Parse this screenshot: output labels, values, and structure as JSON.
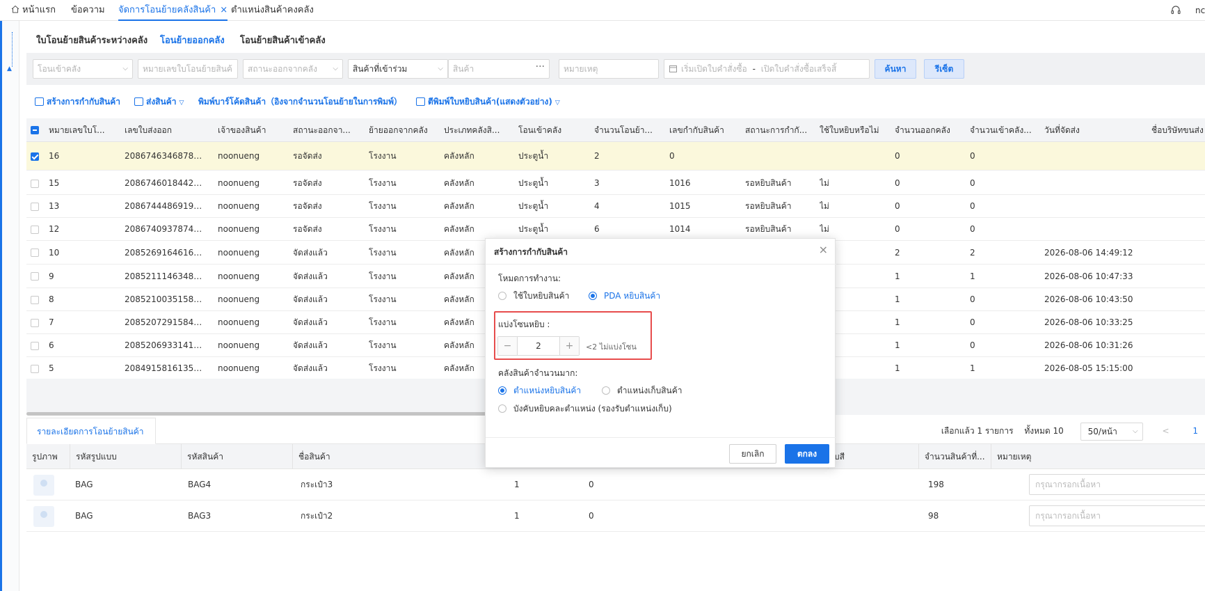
{
  "top_tabs": [
    {
      "label": "หน้าแรก"
    },
    {
      "label": "ข้อความ"
    },
    {
      "label": "จัดการโอนย้ายคลังสินค้า"
    },
    {
      "label": "ตำแหน่งสินค้าคงคลัง"
    }
  ],
  "top_right_text": "nc",
  "sub_tabs": [
    {
      "label": "ใบโอนย้ายสินค้าระหว่างคลัง"
    },
    {
      "label": "โอนย้ายออกคลัง"
    },
    {
      "label": "โอนย้ายสินค้าเข้าคลัง"
    }
  ],
  "filters": {
    "in_warehouse": "โอนเข้าคลัง",
    "transfer_no": "หมายเลขใบโอนย้ายสินค้",
    "out_status": "สถานะออกจากคลัง",
    "product_combo": "สินค้าที่เข้าร่วม",
    "product": "สินค้า",
    "remark": "หมายเหตุ",
    "date_start": "เริ่มเปิดใบคำสั่งซื้อ",
    "date_sep": "-",
    "date_end": "เปิดใบคำสั่งซื้อเสร็จสิ้",
    "search_label": "ค้นหา",
    "reset_label": "รีเซ็ต"
  },
  "actions": {
    "create_binding": "สร้างการกำกับสินค้า",
    "ship": "ส่งสินค้า",
    "print_barcode": "พิมพ์บาร์โค้ดสินค้า（อิงจากจำนวนโอนย้ายในการพิมพ์）",
    "print_pick": "ตีพิมพ์ใบหยิบสินค้า(แสดงตัวอย่าง)"
  },
  "table": {
    "headers": [
      "หมายเลขใบโ...",
      "เลขใบส่งออก",
      "เจ้าของสินค้า",
      "สถานะออกจา...",
      "ย้ายออกจากคลัง",
      "ประเภทคลังสิ...",
      "โอนเข้าคลัง",
      "จำนวนโอนย้า...",
      "เลขกำกับสินค้า",
      "สถานะการกำกั...",
      "ใช้ใบหยิบหรือไม่",
      "จำนวนออกคลัง",
      "จำนวนเข้าคลัง...",
      "วันที่จัดส่ง",
      "ชื่อบริษัทขนส่ง"
    ],
    "rows": [
      [
        "16",
        "208674634687836...",
        "noonueng",
        "รอจัดส่ง",
        "โรงงาน",
        "คลังหลัก",
        "ประตูน้ำ",
        "2",
        "0",
        "",
        "",
        "0",
        "0",
        ""
      ],
      [
        "15",
        "208674601844207...",
        "noonueng",
        "รอจัดส่ง",
        "โรงงาน",
        "คลังหลัก",
        "ประตูน้ำ",
        "3",
        "1016",
        "รอหยิบสินค้า",
        "ไม่",
        "0",
        "0",
        ""
      ],
      [
        "13",
        "208674448691949...",
        "noonueng",
        "รอจัดส่ง",
        "โรงงาน",
        "คลังหลัก",
        "ประตูน้ำ",
        "4",
        "1015",
        "รอหยิบสินค้า",
        "ไม่",
        "0",
        "0",
        ""
      ],
      [
        "12",
        "208674093787456...",
        "noonueng",
        "รอจัดส่ง",
        "โรงงาน",
        "คลังหลัก",
        "ประตูน้ำ",
        "6",
        "1014",
        "รอหยิบสินค้า",
        "ไม่",
        "0",
        "0",
        ""
      ],
      [
        "10",
        "208526916461642...",
        "noonueng",
        "จัดส่งแล้ว",
        "โรงงาน",
        "คลังหลัก",
        "",
        "",
        "",
        "",
        "",
        "2",
        "2",
        "2026-08-06 14:49:12"
      ],
      [
        "9",
        "208521114634899...",
        "noonueng",
        "จัดส่งแล้ว",
        "โรงงาน",
        "คลังหลัก",
        "",
        "",
        "",
        "",
        "",
        "1",
        "1",
        "2026-08-06 10:47:33"
      ],
      [
        "8",
        "208521003515832...",
        "noonueng",
        "จัดส่งแล้ว",
        "โรงงาน",
        "คลังหลัก",
        "",
        "",
        "",
        "",
        "",
        "1",
        "0",
        "2026-08-06 10:43:50"
      ],
      [
        "7",
        "208520729158438...",
        "noonueng",
        "จัดส่งแล้ว",
        "โรงงาน",
        "คลังหลัก",
        "",
        "",
        "",
        "",
        "",
        "1",
        "0",
        "2026-08-06 10:33:25"
      ],
      [
        "6",
        "208520693314147...",
        "noonueng",
        "จัดส่งแล้ว",
        "โรงงาน",
        "คลังหลัก",
        "",
        "",
        "",
        "",
        "",
        "1",
        "0",
        "2026-08-06 10:31:26"
      ],
      [
        "5",
        "208491581613515...",
        "noonueng",
        "จัดส่งแล้ว",
        "โรงงาน",
        "คลังหลัก",
        "",
        "",
        "",
        "",
        "",
        "1",
        "1",
        "2026-08-05 15:15:00"
      ]
    ]
  },
  "detail": {
    "tab_label": "รายละเอียดการโอนย้ายสินค้า",
    "pager_selected": "เลือกแล้ว 1 รายการ",
    "pager_total": "ทั้งหมด 10",
    "pager_size": "50/หน้า",
    "pager_prev": "<",
    "pager_page": "1",
    "headers": [
      "รูปภาพ",
      "รหัสรูปแบบ",
      "รหัสสินค้า",
      "ชื่อสินค้า",
      "บสี",
      "จำนวนสินค้าที่...",
      "หมายเหตุ"
    ],
    "rows": [
      {
        "style": "BAG",
        "sku": "BAG4",
        "name": "กระเป๋า3",
        "c1": "1",
        "c2": "0",
        "count": "198"
      },
      {
        "style": "BAG",
        "sku": "BAG3",
        "name": "กระเป๋า2",
        "c1": "1",
        "c2": "0",
        "count": "98"
      }
    ],
    "remark_placeholder": "กรุณากรอกเนื้อหา"
  },
  "modal": {
    "title": "สร้างการกำกับสินค้า",
    "mode_label": "โหมดการทำงาน:",
    "mode_opt1": "ใช้ใบหยิบสินค้า",
    "mode_opt2": "PDA หยิบสินค้า",
    "zone_label": "แบ่งโซนหยิบ :",
    "zone_minus": "−",
    "zone_value": "2",
    "zone_plus": "+",
    "zone_hint": "<2 ไม่แบ่งโซน",
    "bulk_label": "คลังสินค้าจำนวนมาก:",
    "bulk_opt1": "ตำแหน่งหยิบสินค้า",
    "bulk_opt2": "ตำแหน่งเก็บสินค้า",
    "bulk_opt3": "บังคับหยิบคละตำแหน่ง (รองรับตำแหน่งเก็บ)",
    "cancel_label": "ยกเลิก",
    "ok_label": "ตกลง"
  }
}
